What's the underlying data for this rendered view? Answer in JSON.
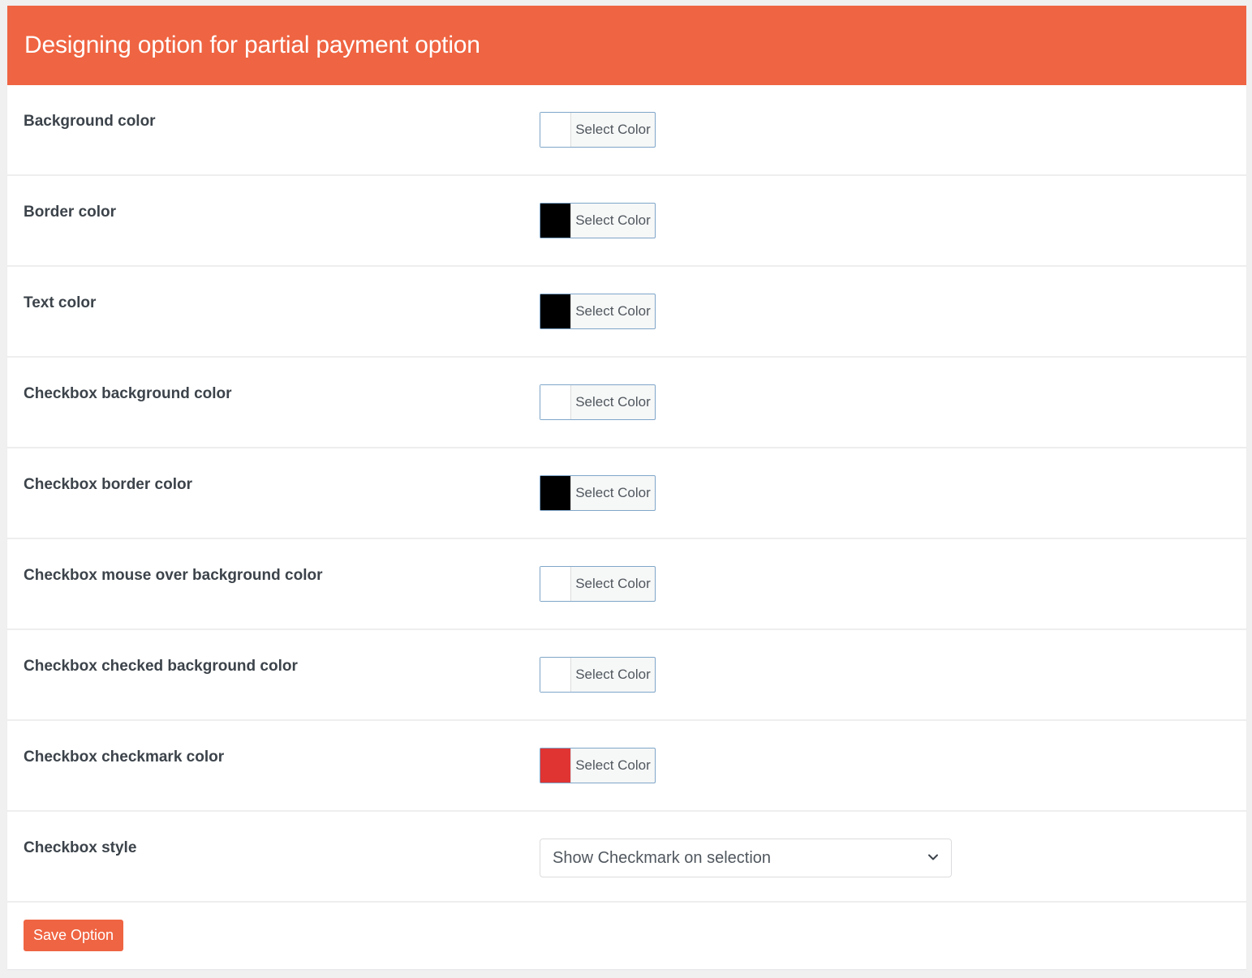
{
  "header": {
    "title": "Designing option for partial payment option"
  },
  "colors": {
    "accent": "#ef6442"
  },
  "rows": [
    {
      "label": "Background color",
      "button_label": "Select Color",
      "swatch": "#ffffff"
    },
    {
      "label": "Border color",
      "button_label": "Select Color",
      "swatch": "#000000"
    },
    {
      "label": "Text color",
      "button_label": "Select Color",
      "swatch": "#000000"
    },
    {
      "label": "Checkbox background color",
      "button_label": "Select Color",
      "swatch": "#ffffff"
    },
    {
      "label": "Checkbox border color",
      "button_label": "Select Color",
      "swatch": "#000000"
    },
    {
      "label": "Checkbox mouse over background color",
      "button_label": "Select Color",
      "swatch": "#ffffff"
    },
    {
      "label": "Checkbox checked background color",
      "button_label": "Select Color",
      "swatch": "#ffffff"
    },
    {
      "label": "Checkbox checkmark color",
      "button_label": "Select Color",
      "swatch": "#e03433"
    }
  ],
  "checkbox_style": {
    "label": "Checkbox style",
    "selected": "Show Checkmark on selection",
    "icon": "chevron-down-icon"
  },
  "footer": {
    "save_label": "Save Option"
  }
}
